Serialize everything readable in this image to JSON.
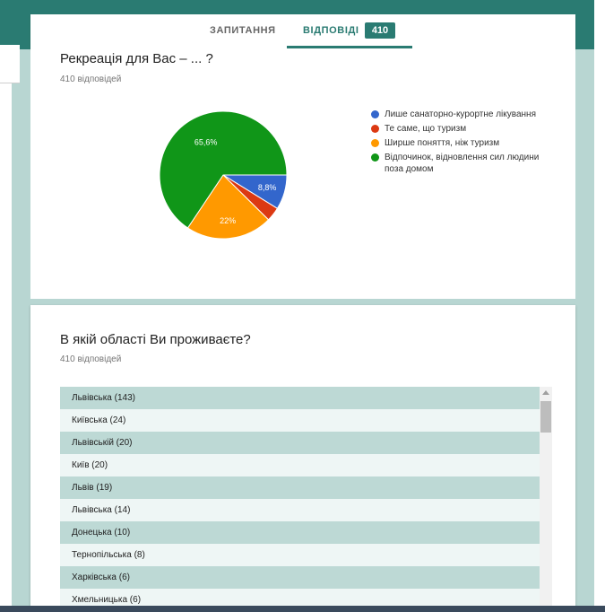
{
  "tabs": {
    "questions": "ЗАПИТАННЯ",
    "answers": "ВІДПОВІДІ",
    "answers_count": "410"
  },
  "q1": {
    "title": "Рекреація для Вас – ... ?",
    "count": "410 відповідей",
    "chart_data": {
      "type": "pie",
      "title": "Рекреація для Вас – ... ?",
      "slices": [
        {
          "label": "Лише санаторно-курортне лікування",
          "value": 8.8,
          "value_label": "8,8%",
          "color": "#3366cc"
        },
        {
          "label": "Те саме, що туризм",
          "value": 3.6,
          "value_label": "",
          "color": "#dc3912"
        },
        {
          "label": "Ширше поняття, ніж туризм",
          "value": 22.0,
          "value_label": "22%",
          "color": "#ff9900"
        },
        {
          "label": "Відпочинок, відновлення сил людини поза домом",
          "value": 65.6,
          "value_label": "65,6%",
          "color": "#109618"
        }
      ],
      "legend_position": "right"
    }
  },
  "q2": {
    "title": "В якій області Ви проживаєте?",
    "count": "410 відповідей",
    "rows": [
      "Львівська (143)",
      "Київська (24)",
      "Львівській (20)",
      "Київ (20)",
      "Львів (19)",
      "Львівська (14)",
      "Донецька (10)",
      "Тернопільська (8)",
      "Харківська (6)",
      "Хмельницька (6)"
    ]
  },
  "colors": {
    "accent": "#2a7b72",
    "band": "#b8d6d2",
    "row_odd": "#bdd9d5",
    "row_even": "#eef6f5"
  }
}
